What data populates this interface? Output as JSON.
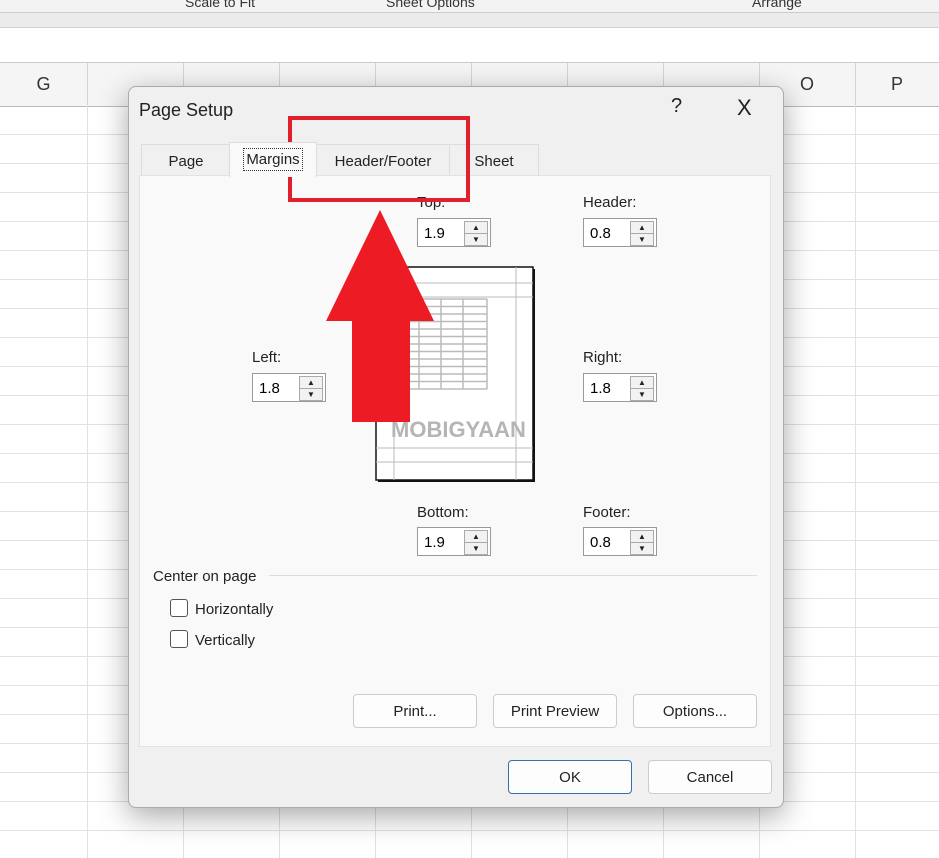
{
  "ribbon": {
    "groups": [
      "Scale to Fit",
      "Sheet Options",
      "Arrange"
    ]
  },
  "columns": [
    "G",
    "",
    "",
    "",
    "",
    "",
    "",
    "",
    "O",
    "P"
  ],
  "dialog": {
    "title": "Page Setup",
    "help": "?",
    "close": "X",
    "tabs": [
      {
        "label": "Page"
      },
      {
        "label": "Margins",
        "active": true
      },
      {
        "label": "Header/Footer"
      },
      {
        "label": "Sheet"
      }
    ],
    "top": {
      "label": "Top:",
      "value": "1.9"
    },
    "header": {
      "label": "Header:",
      "value": "0.8"
    },
    "left": {
      "label": "Left:",
      "value": "1.8"
    },
    "right": {
      "label": "Right:",
      "value": "1.8"
    },
    "bottom": {
      "label": "Bottom:",
      "value": "1.9"
    },
    "footer": {
      "label": "Footer:",
      "value": "0.8"
    },
    "center": {
      "label": "Center on page",
      "horizontally": "Horizontally",
      "vertically": "Vertically",
      "h_checked": false,
      "v_checked": false
    },
    "buttons": {
      "print": "Print...",
      "preview": "Print Preview",
      "options": "Options...",
      "ok": "OK",
      "cancel": "Cancel"
    }
  },
  "watermark": "MOBIGYAAN",
  "annotation": {
    "highlight_color": "#e0202a",
    "arrow_color": "#ed1c24",
    "target": "Header/Footer"
  }
}
